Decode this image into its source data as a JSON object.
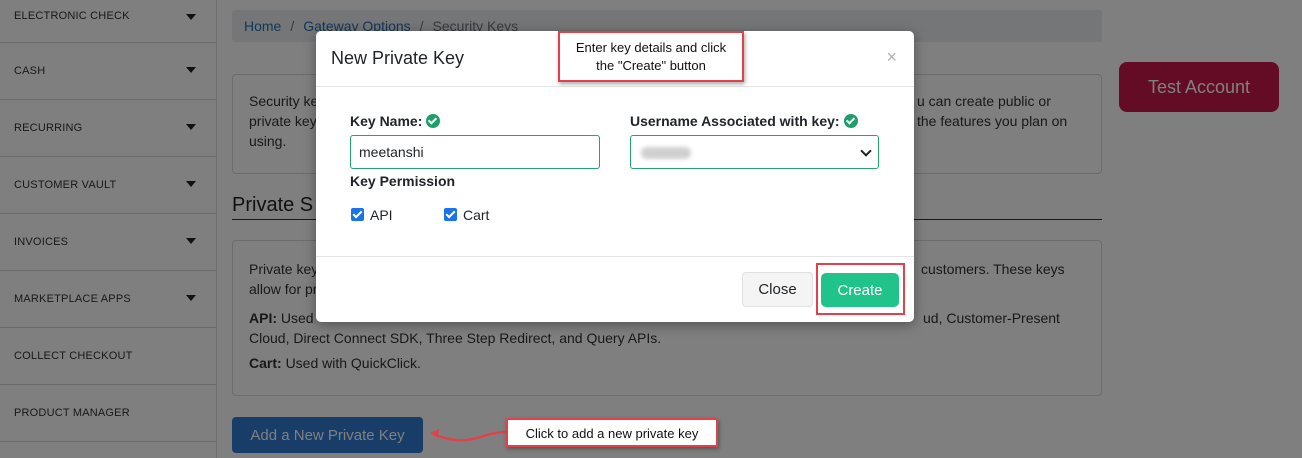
{
  "sidebar": {
    "items": [
      {
        "label": "ELECTRONIC CHECK",
        "has_caret": true
      },
      {
        "label": "CASH",
        "has_caret": true
      },
      {
        "label": "RECURRING",
        "has_caret": true
      },
      {
        "label": "CUSTOMER VAULT",
        "has_caret": true
      },
      {
        "label": "INVOICES",
        "has_caret": true
      },
      {
        "label": "MARKETPLACE APPS",
        "has_caret": true
      },
      {
        "label": "COLLECT CHECKOUT",
        "has_caret": false
      },
      {
        "label": "PRODUCT MANAGER",
        "has_caret": false
      }
    ]
  },
  "breadcrumb": {
    "home": "Home",
    "separator": "/",
    "gateway_options": "Gateway Options",
    "current": "Security Keys"
  },
  "security_card": {
    "left_lines": [
      "Security ke",
      "private key",
      "using."
    ],
    "right_lines": [
      "u can create public or",
      "the features you plan on"
    ]
  },
  "section": {
    "title_fragment": "Private S"
  },
  "private_card": {
    "line1_left": "Private key",
    "line1_right": "customers. These keys",
    "line2_left": "allow for pr",
    "api_label": "API:",
    "api_text_left": "Used",
    "api_text_right": "ud, Customer-Present",
    "api_line2": "Cloud, Direct Connect SDK, Three Step Redirect, and Query APIs.",
    "cart_label": "Cart:",
    "cart_text": "Used with QuickClick."
  },
  "buttons": {
    "add_private_key": "Add a New Private Key",
    "test_account": "Test Account"
  },
  "modal": {
    "title": "New Private Key",
    "close_x": "×",
    "key_name_label": "Key Name:",
    "key_name_value": "meetanshi",
    "username_label": "Username Associated with key:",
    "key_permission_label": "Key Permission",
    "permissions": [
      {
        "label": "API",
        "checked": true
      },
      {
        "label": "Cart",
        "checked": true
      }
    ],
    "close_button": "Close",
    "create_button": "Create"
  },
  "annotations": {
    "callout_top_line1": "Enter key details and click",
    "callout_top_line2": "the \"Create\" button",
    "callout_bottom": "Click to add a new private key"
  },
  "colors": {
    "create_button": "#20c38a",
    "add_key_button": "#2f7bd0",
    "test_account_button": "#c8184a",
    "annotation_red": "#e0424c",
    "valid_green": "#25a36e"
  }
}
